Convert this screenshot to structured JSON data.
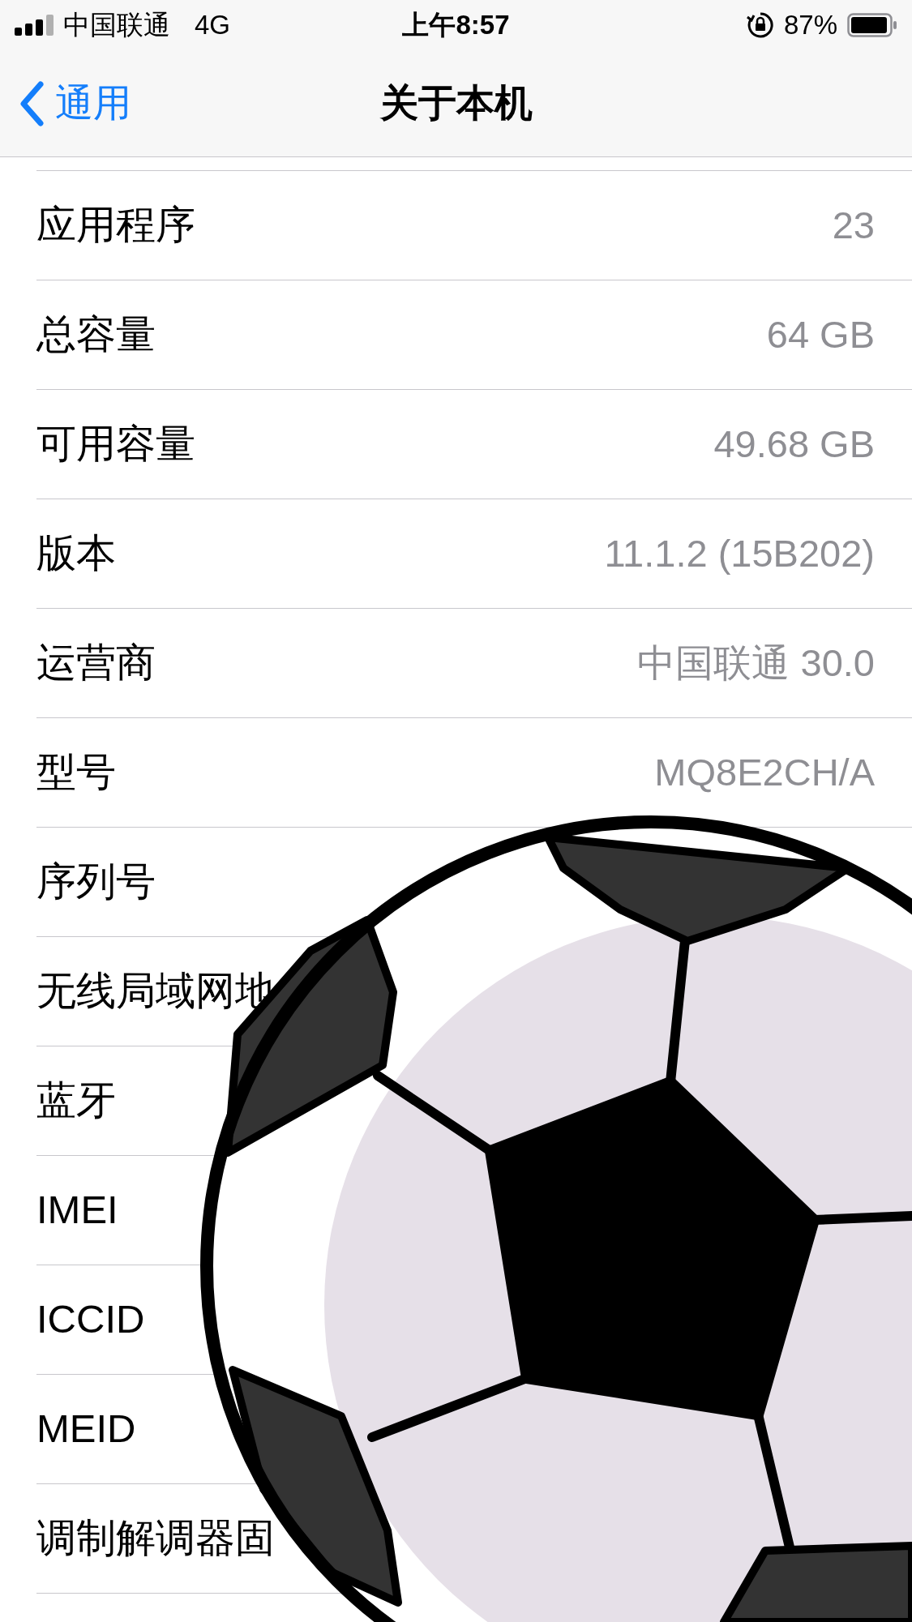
{
  "status_bar": {
    "carrier": "中国联通",
    "network": "4G",
    "time": "上午8:57",
    "battery": "87%"
  },
  "nav": {
    "back": "通用",
    "title": "关于本机"
  },
  "rows": [
    {
      "label": "应用程序",
      "value": "23"
    },
    {
      "label": "总容量",
      "value": "64 GB"
    },
    {
      "label": "可用容量",
      "value": "49.68 GB"
    },
    {
      "label": "版本",
      "value": "11.1.2 (15B202)"
    },
    {
      "label": "运营商",
      "value": "中国联通 30.0"
    },
    {
      "label": "型号",
      "value": "MQ8E2CH/A"
    },
    {
      "label": "序列号"
    },
    {
      "label": "无线局域网地"
    },
    {
      "label": "蓝牙"
    },
    {
      "label": "IMEI"
    },
    {
      "label": "ICCID"
    },
    {
      "label": "MEID"
    },
    {
      "label": "调制解调器固"
    }
  ],
  "overlay": {
    "kind": "soccer-ball"
  }
}
